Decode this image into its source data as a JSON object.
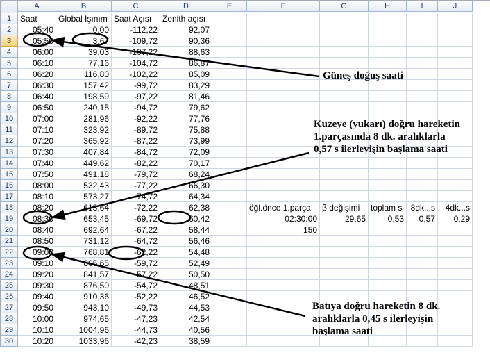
{
  "columns": [
    "",
    "A",
    "B",
    "C",
    "D",
    "E",
    "F",
    "G",
    "H",
    "I",
    "J"
  ],
  "header_row": [
    "1",
    "Saat",
    "Global Işınım",
    "Saat Açısı",
    "Zenith açısı",
    "",
    "",
    "",
    "",
    "",
    ""
  ],
  "rows": [
    {
      "n": "2",
      "cells": [
        "05:40",
        "0,00",
        "-112,22",
        "92,07",
        "",
        "",
        "",
        "",
        "",
        ""
      ]
    },
    {
      "n": "3",
      "cells": [
        "05:50",
        "3,67",
        "-109,72",
        "90,36",
        "",
        "",
        "",
        "",
        "",
        ""
      ],
      "sel": true
    },
    {
      "n": "4",
      "cells": [
        "06:00",
        "39,03",
        "-107,22",
        "88,63",
        "",
        "",
        "",
        "",
        "",
        ""
      ]
    },
    {
      "n": "5",
      "cells": [
        "06:10",
        "77,16",
        "-104,72",
        "86,87",
        "",
        "",
        "",
        "",
        "",
        ""
      ]
    },
    {
      "n": "6",
      "cells": [
        "06:20",
        "116,80",
        "-102,22",
        "85,09",
        "",
        "",
        "",
        "",
        "",
        ""
      ]
    },
    {
      "n": "7",
      "cells": [
        "06:30",
        "157,42",
        "-99,72",
        "83,29",
        "",
        "",
        "",
        "",
        "",
        ""
      ]
    },
    {
      "n": "8",
      "cells": [
        "06:40",
        "198,59",
        "-97,22",
        "81,46",
        "",
        "",
        "",
        "",
        "",
        ""
      ]
    },
    {
      "n": "9",
      "cells": [
        "06:50",
        "240,15",
        "-94,72",
        "79,62",
        "",
        "",
        "",
        "",
        "",
        ""
      ]
    },
    {
      "n": "10",
      "cells": [
        "07:00",
        "281,96",
        "-92,22",
        "77,76",
        "",
        "",
        "",
        "",
        "",
        ""
      ]
    },
    {
      "n": "11",
      "cells": [
        "07:10",
        "323,92",
        "-89,72",
        "75,88",
        "",
        "",
        "",
        "",
        "",
        ""
      ]
    },
    {
      "n": "12",
      "cells": [
        "07:20",
        "365,92",
        "-87,22",
        "73,99",
        "",
        "",
        "",
        "",
        "",
        ""
      ]
    },
    {
      "n": "13",
      "cells": [
        "07:30",
        "407,84",
        "-84,72",
        "72,09",
        "",
        "",
        "",
        "",
        "",
        ""
      ]
    },
    {
      "n": "14",
      "cells": [
        "07:40",
        "449,62",
        "-82,22",
        "70,17",
        "",
        "",
        "",
        "",
        "",
        ""
      ]
    },
    {
      "n": "15",
      "cells": [
        "07:50",
        "491,18",
        "-79,72",
        "68,24",
        "",
        "",
        "",
        "",
        "",
        ""
      ]
    },
    {
      "n": "16",
      "cells": [
        "08:00",
        "532,43",
        "-77,22",
        "66,30",
        "",
        "",
        "",
        "",
        "",
        ""
      ]
    },
    {
      "n": "17",
      "cells": [
        "08:10",
        "573,27",
        "-74,72",
        "64,34",
        "",
        "",
        "",
        "",
        "",
        ""
      ]
    },
    {
      "n": "18",
      "cells": [
        "08:20",
        "613,64",
        "-72,22",
        "62,38",
        "",
        "öğl.önce 1.parça",
        "β değişimi",
        "toplam s",
        "8dk...s",
        "4dk...s"
      ]
    },
    {
      "n": "19",
      "cells": [
        "08:30",
        "653,45",
        "-69,72",
        "60,42",
        "",
        "02:30:00",
        "29,65",
        "0,53",
        "0,57",
        "0,29"
      ]
    },
    {
      "n": "20",
      "cells": [
        "08:40",
        "692,64",
        "-67,22",
        "58,44",
        "",
        "150",
        "",
        "",
        "",
        ""
      ]
    },
    {
      "n": "21",
      "cells": [
        "08:50",
        "731,12",
        "-64,72",
        "56,46",
        "",
        "",
        "",
        "",
        "",
        ""
      ]
    },
    {
      "n": "22",
      "cells": [
        "09:00",
        "768,81",
        "-62,22",
        "54,48",
        "",
        "",
        "",
        "",
        "",
        ""
      ]
    },
    {
      "n": "23",
      "cells": [
        "09:10",
        "805,65",
        "-59,72",
        "52,49",
        "",
        "",
        "",
        "",
        "",
        ""
      ]
    },
    {
      "n": "24",
      "cells": [
        "09:20",
        "841,57",
        "-57,22",
        "50,50",
        "",
        "",
        "",
        "",
        "",
        ""
      ]
    },
    {
      "n": "25",
      "cells": [
        "09:30",
        "876,50",
        "-54,72",
        "48,51",
        "",
        "",
        "",
        "",
        "",
        ""
      ]
    },
    {
      "n": "26",
      "cells": [
        "09:40",
        "910,36",
        "-52,22",
        "46,52",
        "",
        "",
        "",
        "",
        "",
        ""
      ]
    },
    {
      "n": "27",
      "cells": [
        "09:50",
        "943,10",
        "-49,73",
        "44,53",
        "",
        "",
        "",
        "",
        "",
        ""
      ]
    },
    {
      "n": "28",
      "cells": [
        "10:00",
        "974,65",
        "-47,23",
        "42,54",
        "",
        "",
        "",
        "",
        "",
        ""
      ]
    },
    {
      "n": "29",
      "cells": [
        "10:10",
        "1004,96",
        "-44,73",
        "40,56",
        "",
        "",
        "",
        "",
        "",
        ""
      ]
    },
    {
      "n": "30",
      "cells": [
        "10:20",
        "1033,96",
        "-42,23",
        "38,59",
        "",
        "",
        "",
        "",
        "",
        ""
      ]
    }
  ],
  "callouts": {
    "c1": "Güneş doğuş saati",
    "c2_l1": "Kuzeye (yukarı) doğru hareketin",
    "c2_l2": "1.parçasında 8 dk. aralıklarla",
    "c2_l3": "0,57 s ilerleyişin başlama saati",
    "c3_l1": "Batıya doğru hareketin 8 dk.",
    "c3_l2": "aralıklarla 0,45 s ilerleyişin",
    "c3_l3": "başlama saati"
  }
}
